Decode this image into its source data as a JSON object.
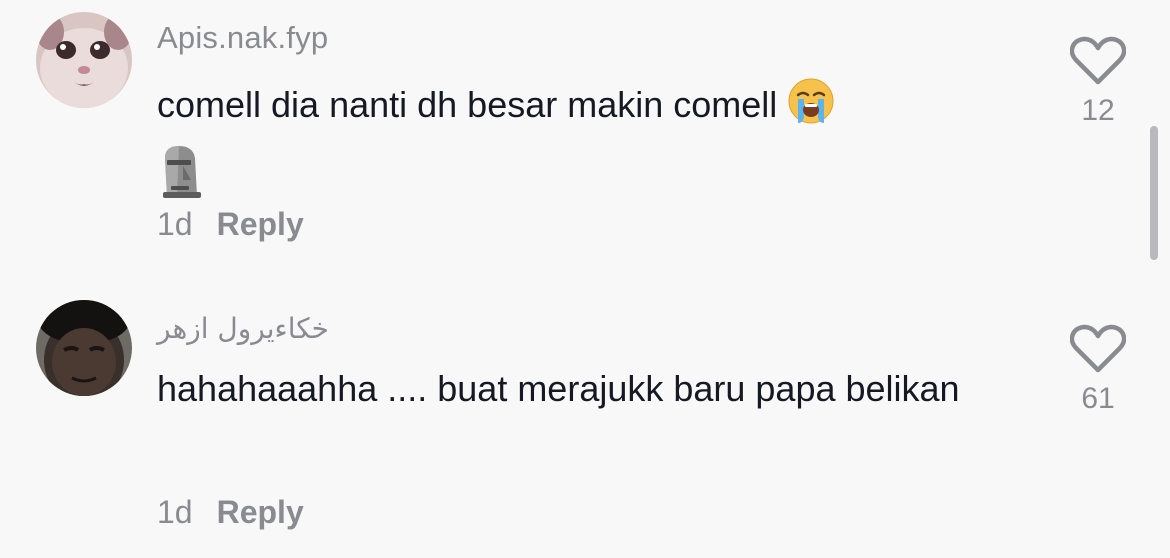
{
  "comments": [
    {
      "username": "Apis.nak.fyp",
      "text": "comell dia nanti dh besar makin comell",
      "emoji_inline": "loudly-crying-face",
      "emoji_next_line": "moai",
      "age": "1d",
      "reply_label": "Reply",
      "likes": "12"
    },
    {
      "username": "خكاءيرول ازهر",
      "text": "hahahaaahha .... buat merajukk baru papa belikan",
      "age": "1d",
      "reply_label": "Reply",
      "likes": "61"
    }
  ],
  "icons": {
    "like": "heart-outline-icon"
  },
  "colors": {
    "background": "#f8f8f8",
    "text": "#161823",
    "muted": "#8a8b91"
  }
}
